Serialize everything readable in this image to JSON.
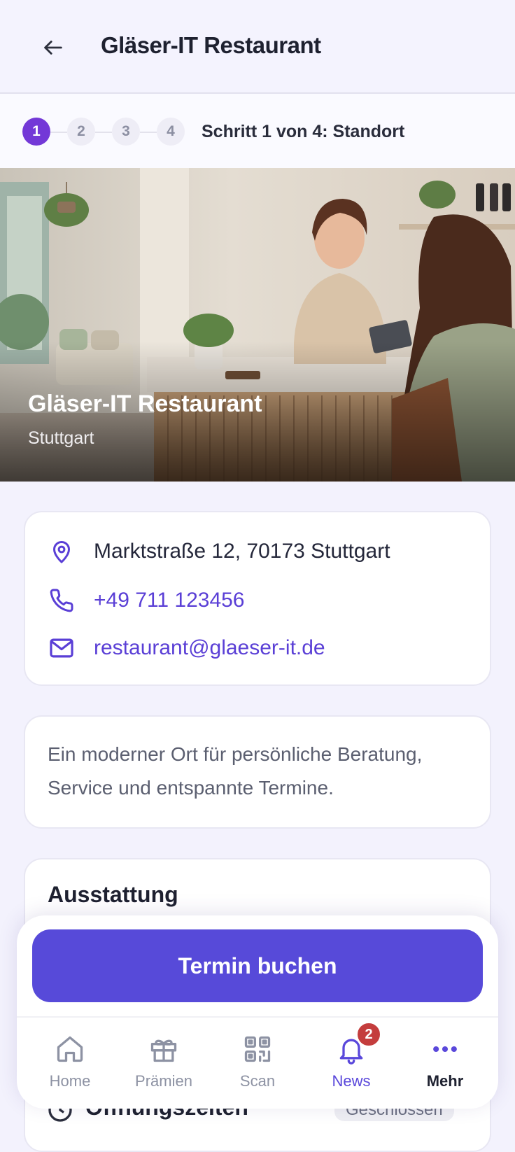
{
  "header": {
    "title": "Gläser-IT Restaurant"
  },
  "steps": {
    "items": [
      "1",
      "2",
      "3",
      "4"
    ],
    "current": 1,
    "label": "Schritt 1 von 4: Standort"
  },
  "hero": {
    "title": "Gläser-IT Restaurant",
    "subtitle": "Stuttgart"
  },
  "contact": {
    "address": "Marktstraße 12, 70173 Stuttgart",
    "phone": "+49 711 123456",
    "email": "restaurant@glaeser-it.de"
  },
  "description": "Ein moderner Ort für persönliche Beratung, Service und entspannte Termine.",
  "amenities": {
    "title": "Ausstattung"
  },
  "opening_hours": {
    "title": "Öffnungszeiten",
    "status": "Geschlossen"
  },
  "cta": {
    "label": "Termin buchen"
  },
  "bottom_nav": {
    "items": [
      {
        "label": "Home",
        "icon": "home-icon"
      },
      {
        "label": "Prämien",
        "icon": "gift-icon"
      },
      {
        "label": "Scan",
        "icon": "qr-code-icon"
      },
      {
        "label": "News",
        "icon": "bell-icon",
        "badge": "2",
        "active": true
      },
      {
        "label": "Mehr",
        "icon": "more-icon"
      }
    ]
  },
  "colors": {
    "accent": "#574ad9",
    "step_active": "#7338d7",
    "link": "#5a3fd6",
    "badge": "#c43d3d",
    "background": "#f3f2fd"
  }
}
